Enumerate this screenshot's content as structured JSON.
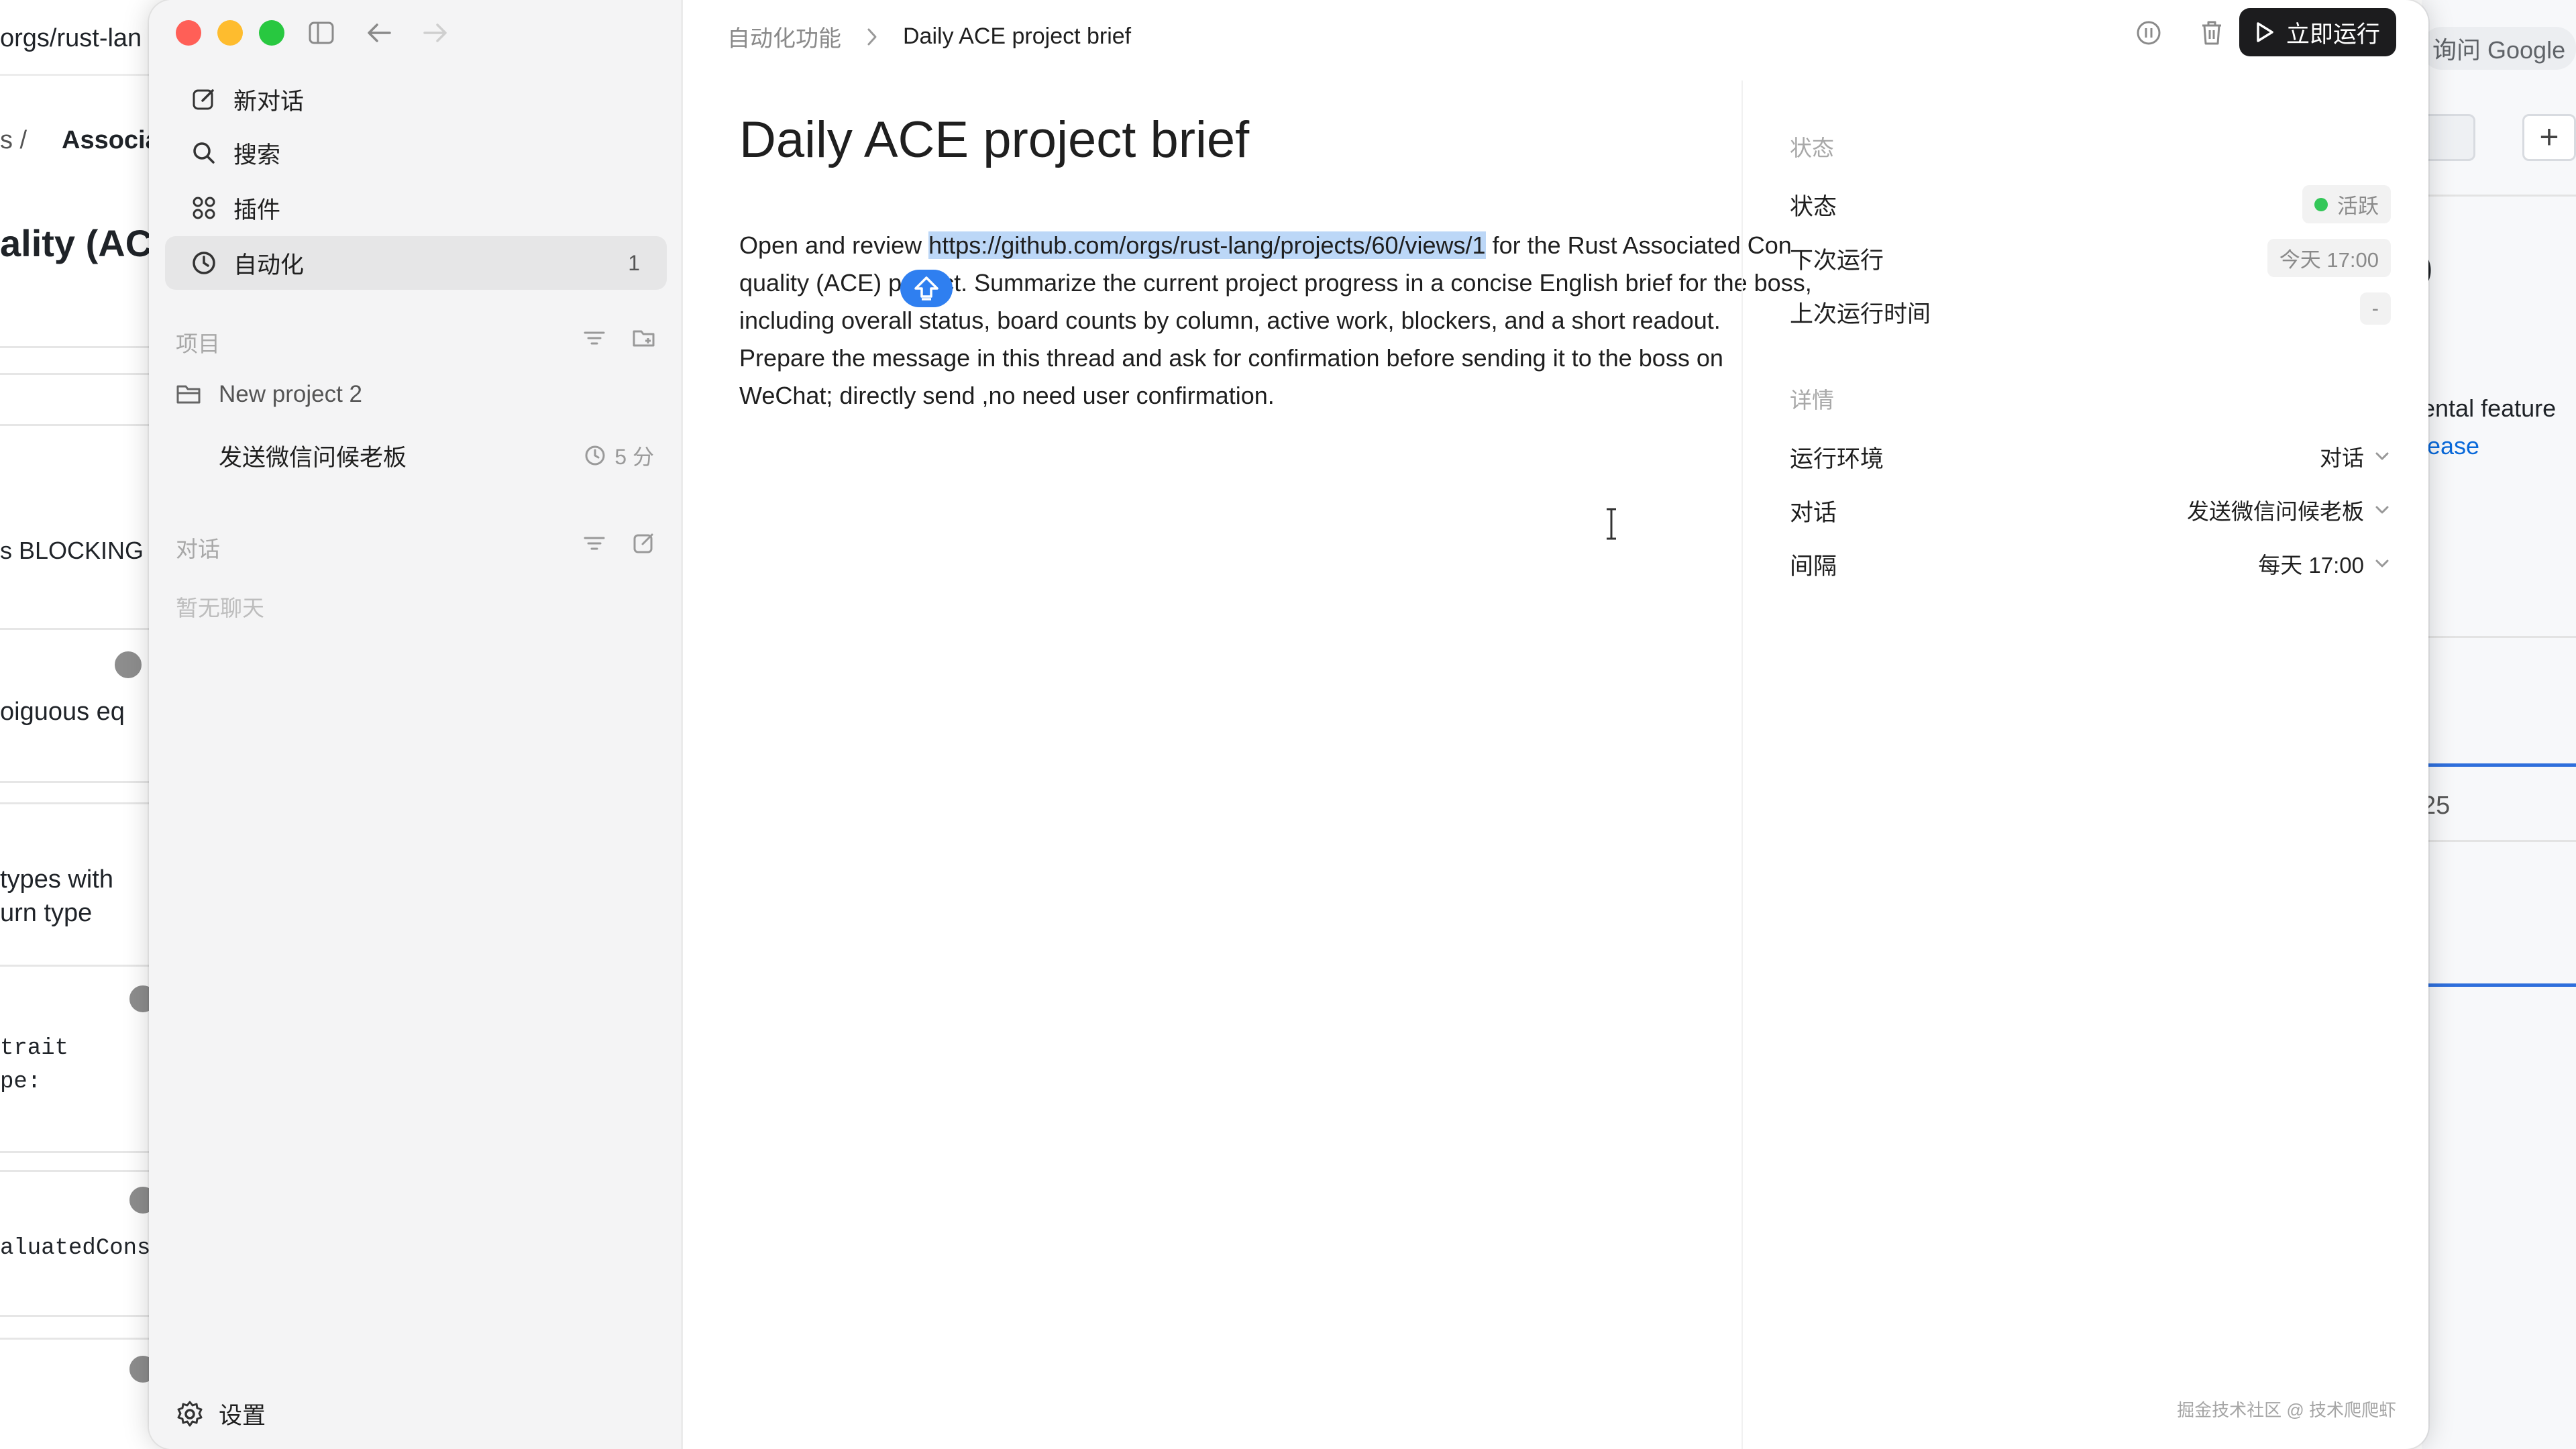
{
  "bg_left": {
    "url": "orgs/rust-lan",
    "crumb_sep": "s  /",
    "crumb": "Associa",
    "heading": "ality (ACE",
    "blocking": "s BLOCKING t",
    "eq": "oiguous eq",
    "types1": "types with",
    "types2": "urn type",
    "trait": "trait",
    "pe": "pe:",
    "const": "aluatedConst"
  },
  "bg_right": {
    "google": "询问 Google",
    "plus": "+",
    "paren": ")",
    "feature": "ental feature",
    "release": "lease",
    "num": "25"
  },
  "sidebar": {
    "nav": [
      {
        "label": "新对话"
      },
      {
        "label": "搜索"
      },
      {
        "label": "插件"
      },
      {
        "label": "自动化",
        "count": "1"
      }
    ],
    "projects_header": "项目",
    "project_name": "New project 2",
    "task_name": "发送微信问候老板",
    "task_meta": "5 分",
    "chats_header": "对话",
    "chats_empty": "暂无聊天",
    "settings": "设置"
  },
  "main": {
    "breadcrumb_parent": "自动化功能",
    "breadcrumb_current": "Daily ACE project brief",
    "run_button": "立即运行",
    "title": "Daily ACE project brief",
    "prompt_pre": "Open and review ",
    "prompt_link": "https://github.com/orgs/rust-lang/projects/60/views/1",
    "prompt_post": " for the Rust Associated Con  quality (ACE) project. Summarize the current project progress in a concise English brief for the boss, including overall status, board counts by column, active work, blockers, and a short readout. Prepare the message in this thread and ask for confirmation before sending it to the boss on WeChat;  directly  send ,no need  user confirmation."
  },
  "right_panel": {
    "status_header": "状态",
    "status_label": "状态",
    "status_value": "活跃",
    "next_run_label": "下次运行",
    "next_run_value": "今天 17:00",
    "last_run_label": "上次运行时间",
    "last_run_value": "-",
    "details_header": "详情",
    "env_label": "运行环境",
    "env_value": "对话",
    "chat_label": "对话",
    "chat_value": "发送微信问候老板",
    "interval_label": "间隔",
    "interval_value": "每天 17:00"
  },
  "colors": {
    "run_button_bg": "#1c1c1e",
    "status_active": "#34c759",
    "link_highlight": "#bcd7f7",
    "cursor_badge": "#2f7ff0"
  },
  "watermark": "掘金技术社区 @ 技术爬爬虾"
}
